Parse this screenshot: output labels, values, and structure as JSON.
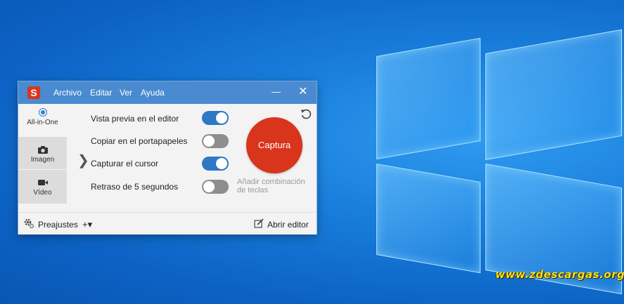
{
  "desktop": {
    "watermark": "www.zdescargas.org"
  },
  "app": {
    "logo_letter": "S",
    "menu": [
      "Archivo",
      "Editar",
      "Ver",
      "Ayuda"
    ],
    "minimize_glyph": "—",
    "close_glyph": "✕"
  },
  "modes": [
    {
      "label": "All-in-One",
      "icon": "radio-selected-icon",
      "selected": true
    },
    {
      "label": "Imagen",
      "icon": "camera-icon",
      "selected": false
    },
    {
      "label": "Vídeo",
      "icon": "video-camera-icon",
      "selected": false
    }
  ],
  "expand_glyph": "❯",
  "options": [
    {
      "label": "Vista previa en el editor",
      "on": true
    },
    {
      "label": "Copiar en el portapapeles",
      "on": false
    },
    {
      "label": "Capturar el cursor",
      "on": true
    },
    {
      "label": "Retraso de 5 segundos",
      "on": false
    }
  ],
  "capture_button": "Captura",
  "hotkey_line1": "Añadir combinación",
  "hotkey_line2": "de teclas",
  "footer": {
    "presets": "Preajustes",
    "add_glyph": "+▾",
    "open_editor": "Abrir editor"
  },
  "colors": {
    "titlebar": "#4a8ad0",
    "capture": "#d9341c",
    "toggle_on": "#2f78c4",
    "toggle_off": "#8e8e8e"
  }
}
